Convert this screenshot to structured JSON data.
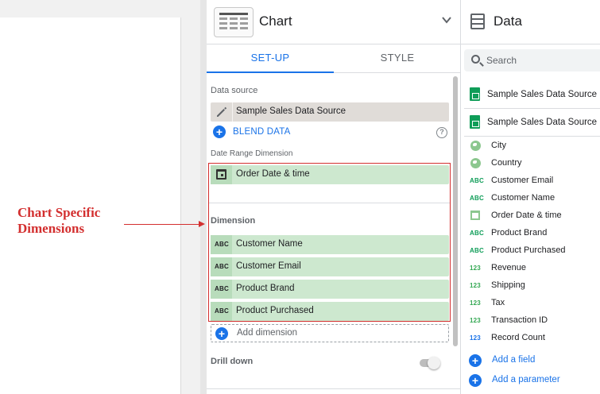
{
  "annotation": {
    "line1": "Chart Specific",
    "line2": "Dimensions",
    "color": "#d32f2f"
  },
  "panel": {
    "title": "Chart",
    "tabs": [
      {
        "label": "SET-UP",
        "active": true
      },
      {
        "label": "STYLE",
        "active": false
      }
    ],
    "data_source_label": "Data source",
    "data_source_value": "Sample Sales Data Source",
    "blend_label": "BLEND DATA",
    "date_range_label": "Date Range Dimension",
    "date_range_value": "Order Date & time",
    "dimension_label": "Dimension",
    "dimensions": [
      {
        "icon": "ABC",
        "label": "Customer Name"
      },
      {
        "icon": "ABC",
        "label": "Customer Email"
      },
      {
        "icon": "ABC",
        "label": "Product Brand"
      },
      {
        "icon": "ABC",
        "label": "Product Purchased"
      }
    ],
    "add_dimension_label": "Add dimension",
    "drill_down_label": "Drill down"
  },
  "data_panel": {
    "title": "Data",
    "search_placeholder": "Search",
    "sources": [
      "Sample Sales Data Source",
      "Sample Sales Data Source"
    ],
    "fields": [
      {
        "type": "geo",
        "label": "City"
      },
      {
        "type": "geo",
        "label": "Country"
      },
      {
        "type": "ABC",
        "label": "Customer Email"
      },
      {
        "type": "ABC",
        "label": "Customer Name"
      },
      {
        "type": "date",
        "label": "Order Date & time"
      },
      {
        "type": "ABC",
        "label": "Product Brand"
      },
      {
        "type": "ABC",
        "label": "Product Purchased"
      },
      {
        "type": "123",
        "label": "Revenue"
      },
      {
        "type": "123",
        "label": "Shipping"
      },
      {
        "type": "123",
        "label": "Tax"
      },
      {
        "type": "123",
        "label": "Transaction ID"
      },
      {
        "type": "123b",
        "label": "Record Count"
      }
    ],
    "add_field_label": "Add a field",
    "add_parameter_label": "Add a parameter"
  },
  "colors": {
    "accent": "#1a73e8",
    "dimension_chip": "#cde8cf",
    "sheets_green": "#0f9d58"
  }
}
